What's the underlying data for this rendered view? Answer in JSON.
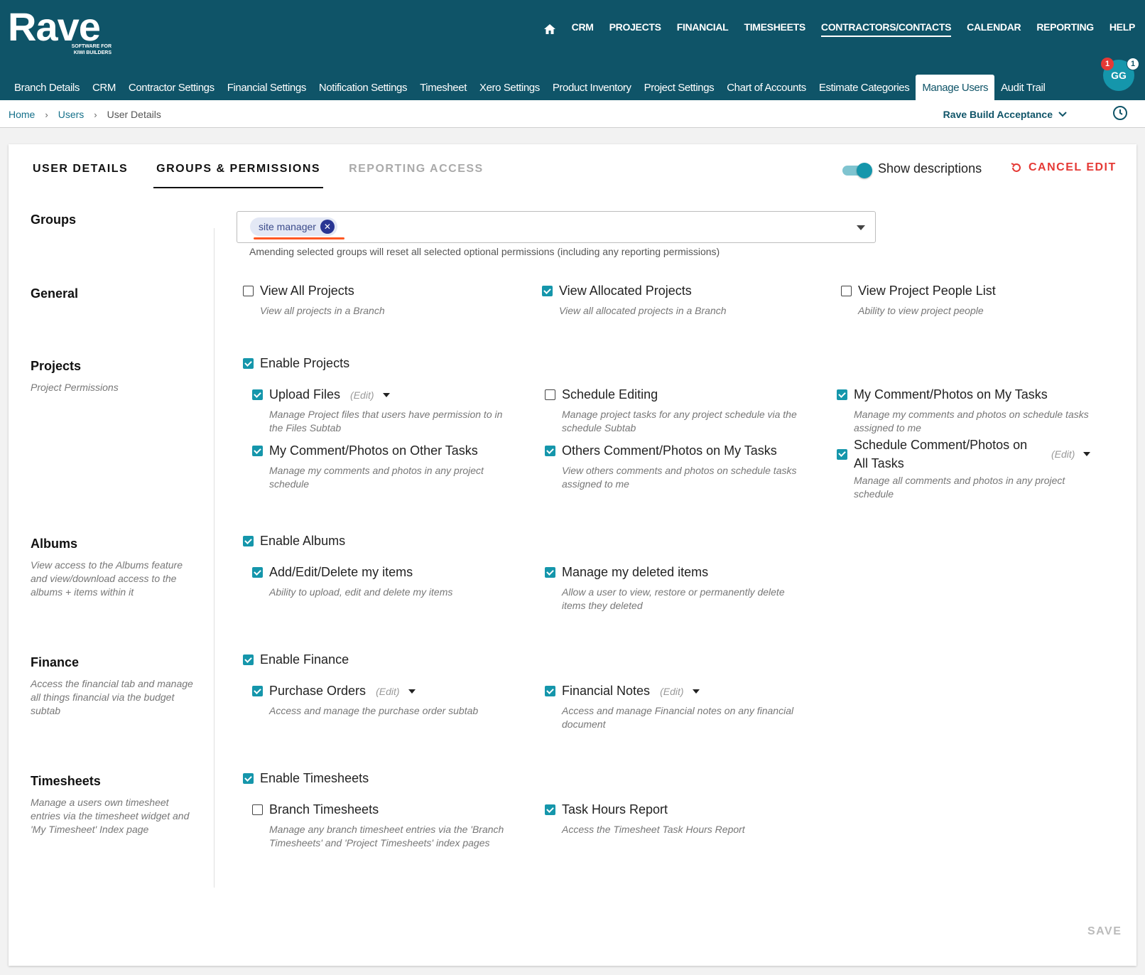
{
  "brand": {
    "name": "Rave",
    "tagline": "SOFTWARE FOR\nKIWI BUILDERS"
  },
  "topnav": {
    "items": [
      "CRM",
      "PROJECTS",
      "FINANCIAL",
      "TIMESHEETS",
      "CONTRACTORS/CONTACTS",
      "CALENDAR",
      "REPORTING",
      "HELP"
    ],
    "active": "CONTRACTORS/CONTACTS"
  },
  "subnav": {
    "items": [
      "Branch Details",
      "CRM",
      "Contractor Settings",
      "Financial Settings",
      "Notification Settings",
      "Timesheet",
      "Xero Settings",
      "Product Inventory",
      "Project Settings",
      "Chart of Accounts",
      "Estimate Categories",
      "Manage Users",
      "Audit Trail"
    ],
    "active": "Manage Users"
  },
  "user": {
    "initials": "GG",
    "badge_left": "1",
    "badge_right": "1"
  },
  "breadcrumb": {
    "home": "Home",
    "users": "Users",
    "current": "User Details"
  },
  "branch": {
    "name": "Rave Build Acceptance"
  },
  "tabs": {
    "user_details": "USER DETAILS",
    "groups_permissions": "GROUPS & PERMISSIONS",
    "reporting_access": "REPORTING ACCESS"
  },
  "toggle": {
    "label": "Show descriptions",
    "on": true
  },
  "cancel_label": "CANCEL EDIT",
  "groups": {
    "title": "Groups",
    "selected": "site manager",
    "help": "Amending selected groups will reset all selected optional permissions (including any reporting permissions)"
  },
  "sections": {
    "general": {
      "title": "General"
    },
    "projects": {
      "title": "Projects",
      "desc": "Project Permissions"
    },
    "albums": {
      "title": "Albums",
      "desc": "View access to the Albums feature and view/download access to the albums + items within it"
    },
    "finance": {
      "title": "Finance",
      "desc": "Access the financial tab and manage all things financial via the budget subtab"
    },
    "timesheets": {
      "title": "Timesheets",
      "desc": "Manage a users own timesheet entries via the timesheet widget and 'My Timesheet' Index page"
    }
  },
  "edit_label": "(Edit)",
  "permissions": {
    "view_all_projects": {
      "label": "View All Projects",
      "desc": "View all projects in a Branch",
      "checked": false
    },
    "view_allocated_projects": {
      "label": "View Allocated Projects",
      "desc": "View all allocated projects in a Branch",
      "checked": true
    },
    "view_project_people": {
      "label": "View Project People List",
      "desc": "Ability to view project people",
      "checked": false
    },
    "enable_projects": {
      "label": "Enable Projects",
      "checked": true
    },
    "upload_files": {
      "label": "Upload Files",
      "desc": "Manage Project files that users have permission to in the Files Subtab",
      "checked": true
    },
    "schedule_editing": {
      "label": "Schedule Editing",
      "desc": "Manage project tasks for any project schedule via the schedule Subtab",
      "checked": false
    },
    "my_comment_my_tasks": {
      "label": "My Comment/Photos on My Tasks",
      "desc": "Manage my comments and photos on schedule tasks assigned to me",
      "checked": true
    },
    "my_comment_other_tasks": {
      "label": "My Comment/Photos on Other Tasks",
      "desc": "Manage my comments and photos in any project schedule",
      "checked": true
    },
    "others_comment_my_tasks": {
      "label": "Others Comment/Photos on My Tasks",
      "desc": "View others comments and photos on schedule tasks assigned to me",
      "checked": true
    },
    "schedule_comment_all_tasks": {
      "label": "Schedule Comment/Photos on All Tasks",
      "desc": "Manage all comments and photos in any project schedule",
      "checked": true
    },
    "enable_albums": {
      "label": "Enable Albums",
      "checked": true
    },
    "add_edit_delete_items": {
      "label": "Add/Edit/Delete my items",
      "desc": "Ability to upload, edit and delete my items",
      "checked": true
    },
    "manage_deleted_items": {
      "label": "Manage my deleted items",
      "desc": "Allow a user to view, restore or permanently delete items they deleted",
      "checked": true
    },
    "enable_finance": {
      "label": "Enable Finance",
      "checked": true
    },
    "purchase_orders": {
      "label": "Purchase Orders",
      "desc": "Access and manage the purchase order subtab",
      "checked": true
    },
    "financial_notes": {
      "label": "Financial Notes",
      "desc": "Access and manage Financial notes on any financial document",
      "checked": true
    },
    "enable_timesheets": {
      "label": "Enable Timesheets",
      "checked": true
    },
    "branch_timesheets": {
      "label": "Branch Timesheets",
      "desc": "Manage any branch timesheet entries via the 'Branch Timesheets' and 'Project Timesheets' index pages",
      "checked": false
    },
    "task_hours_report": {
      "label": "Task Hours Report",
      "desc": "Access the Timesheet Task Hours Report",
      "checked": true
    }
  },
  "save_label": "SAVE",
  "colors": {
    "header": "#0f5468",
    "accent": "#1596ab",
    "danger": "#e53935",
    "chip_underline": "#ff5722"
  }
}
